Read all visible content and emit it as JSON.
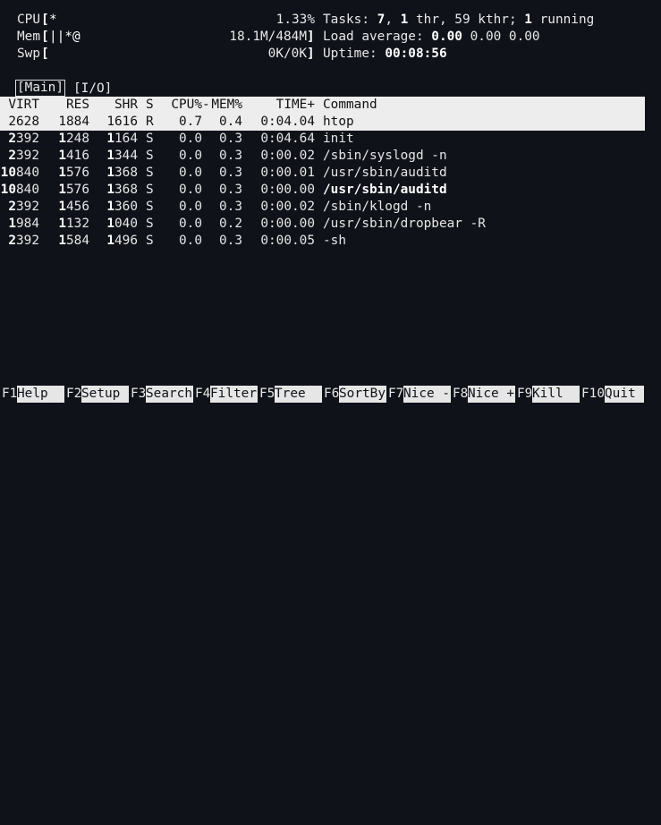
{
  "meters": {
    "cpu": {
      "label": "CPU",
      "open": "[",
      "bar": "*",
      "value": "1.33%",
      "close": ""
    },
    "mem": {
      "label": "Mem",
      "open": "[",
      "bar": "||*@",
      "value": "18.1M/484M",
      "close": "]"
    },
    "swp": {
      "label": "Swp",
      "open": "[",
      "bar": "",
      "value": "0K/0K",
      "close": "]"
    }
  },
  "info": {
    "tasks_label": "Tasks: ",
    "tasks_count": "7",
    "sep1": ", ",
    "thr_count": "1",
    "thr_label": " thr, 59 kthr; ",
    "running_count": "1",
    "running_label": " running",
    "load_label": "Load average: ",
    "load_1": "0.00",
    "load_rest": " 0.00 0.00",
    "uptime_label": "Uptime: ",
    "uptime_value": "00:08:56"
  },
  "tabs": [
    {
      "label": "[Main]",
      "active": true
    },
    {
      "label": "[I/O]",
      "active": false
    }
  ],
  "table": {
    "headers": {
      "virt": "VIRT",
      "res": "RES",
      "shr": "SHR",
      "s": "S",
      "cpu": "CPU%",
      "mem": "MEM%",
      "time": "TIME+",
      "command": "Command"
    },
    "rows": [
      {
        "virt": "2628",
        "res": "1884",
        "shr": "1616",
        "s": "R",
        "cpu": "0.7",
        "mem": "0.4",
        "time": "0:04.04",
        "command": "htop",
        "selected": true
      },
      {
        "virt_lead": "2",
        "virt_rest": "392",
        "res_lead": "1",
        "res_rest": "248",
        "shr_lead": "1",
        "shr_rest": "164",
        "s": "S",
        "cpu": "0.0",
        "mem": "0.3",
        "time": "0:04.64",
        "command": "init"
      },
      {
        "virt_lead": "2",
        "virt_rest": "392",
        "res_lead": "1",
        "res_rest": "416",
        "shr_lead": "1",
        "shr_rest": "344",
        "s": "S",
        "cpu": "0.0",
        "mem": "0.3",
        "time": "0:00.02",
        "command": "/sbin/syslogd -n"
      },
      {
        "virt_lead": "10",
        "virt_rest": "840",
        "res_lead": "1",
        "res_rest": "576",
        "shr_lead": "1",
        "shr_rest": "368",
        "s": "S",
        "cpu": "0.0",
        "mem": "0.3",
        "time": "0:00.01",
        "command": "/usr/sbin/auditd"
      },
      {
        "virt_lead": "10",
        "virt_rest": "840",
        "res_lead": "1",
        "res_rest": "576",
        "shr_lead": "1",
        "shr_rest": "368",
        "s": "S",
        "cpu": "0.0",
        "mem": "0.3",
        "time": "0:00.00",
        "command": "/usr/sbin/auditd",
        "bold_command": true
      },
      {
        "virt_lead": "2",
        "virt_rest": "392",
        "res_lead": "1",
        "res_rest": "456",
        "shr_lead": "1",
        "shr_rest": "360",
        "s": "S",
        "cpu": "0.0",
        "mem": "0.3",
        "time": "0:00.02",
        "command": "/sbin/klogd -n"
      },
      {
        "virt_lead": "1",
        "virt_rest": "984",
        "res_lead": "1",
        "res_rest": "132",
        "shr_lead": "1",
        "shr_rest": "040",
        "s": "S",
        "cpu": "0.0",
        "mem": "0.2",
        "time": "0:00.00",
        "command": "/usr/sbin/dropbear -R"
      },
      {
        "virt_lead": "2",
        "virt_rest": "392",
        "res_lead": "1",
        "res_rest": "584",
        "shr_lead": "1",
        "shr_rest": "496",
        "s": "S",
        "cpu": "0.0",
        "mem": "0.3",
        "time": "0:00.05",
        "command": "-sh"
      }
    ]
  },
  "function_keys": [
    {
      "key": "F1",
      "label": "Help  "
    },
    {
      "key": "F2",
      "label": "Setup "
    },
    {
      "key": "F3",
      "label": "Search"
    },
    {
      "key": "F4",
      "label": "Filter"
    },
    {
      "key": "F5",
      "label": "Tree  "
    },
    {
      "key": "F6",
      "label": "SortBy"
    },
    {
      "key": "F7",
      "label": "Nice -"
    },
    {
      "key": "F8",
      "label": "Nice +"
    },
    {
      "key": "F9",
      "label": "Kill  "
    },
    {
      "key": "F10",
      "label": "Quit"
    }
  ]
}
